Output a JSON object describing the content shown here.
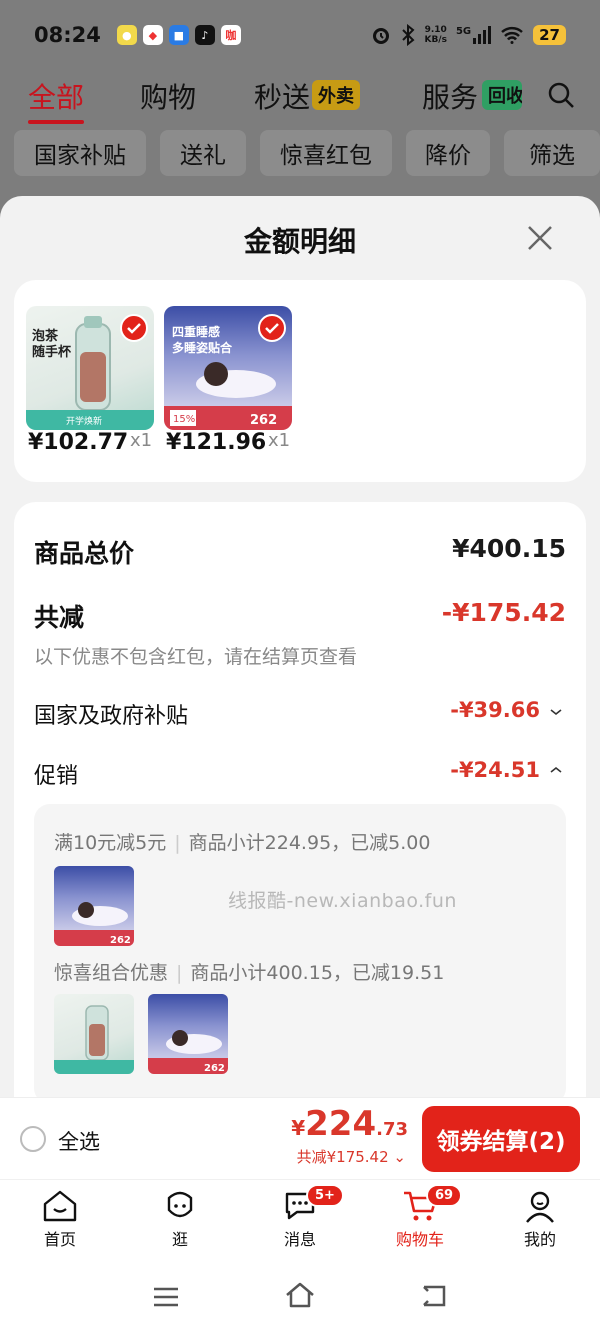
{
  "status_bar": {
    "time": "08:24",
    "app_icons": [
      "pea-icon",
      "fish-icon",
      "blue-app-icon",
      "tiktok-icon",
      "red-app-icon"
    ],
    "network_speed_top": "9.10",
    "network_speed_bottom": "KB/s",
    "signal_label": "5G",
    "battery": "27"
  },
  "top_tabs": [
    {
      "label": "全部",
      "active": true
    },
    {
      "label": "购物"
    },
    {
      "label": "秒送",
      "badge": "外卖"
    },
    {
      "label": "服务",
      "badge": "回收"
    }
  ],
  "filter_chips": [
    "国家补贴",
    "送礼",
    "惊喜红包",
    "降价",
    "筛选"
  ],
  "sheet": {
    "title": "金额明细",
    "items": [
      {
        "name": "tea-cup-product",
        "price": "¥102.77",
        "qty": "x1"
      },
      {
        "name": "pillow-product",
        "price": "¥121.96",
        "qty": "x1"
      }
    ],
    "total_label": "商品总价",
    "total_value": "¥400.15",
    "reduce_label": "共减",
    "reduce_value": "-¥175.42",
    "reduce_note": "以下优惠不包含红包，请在结算页查看",
    "subsidy_label": "国家及政府补贴",
    "subsidy_value": "-¥39.66",
    "promo_label": "促销",
    "promo_value": "-¥24.51",
    "promos": [
      {
        "rule": "满10元减5元",
        "detail": "商品小计224.95，已减5.00"
      },
      {
        "rule": "惊喜组合优惠",
        "detail": "商品小计400.15，已减19.51"
      }
    ],
    "watermark": "线报酷-new.xianbao.fun"
  },
  "checkout": {
    "select_all": "全选",
    "currency": "¥",
    "total_int": "224",
    "total_dec": ".73",
    "save_text": "共减¥175.42",
    "pay_button": "领券结算(2)"
  },
  "tabbar": [
    {
      "label": "首页"
    },
    {
      "label": "逛"
    },
    {
      "label": "消息",
      "badge": "5+"
    },
    {
      "label": "购物车",
      "badge": "69",
      "active": true
    },
    {
      "label": "我的"
    }
  ],
  "colors": {
    "accent": "#e2231a",
    "discount": "#d9372b"
  }
}
